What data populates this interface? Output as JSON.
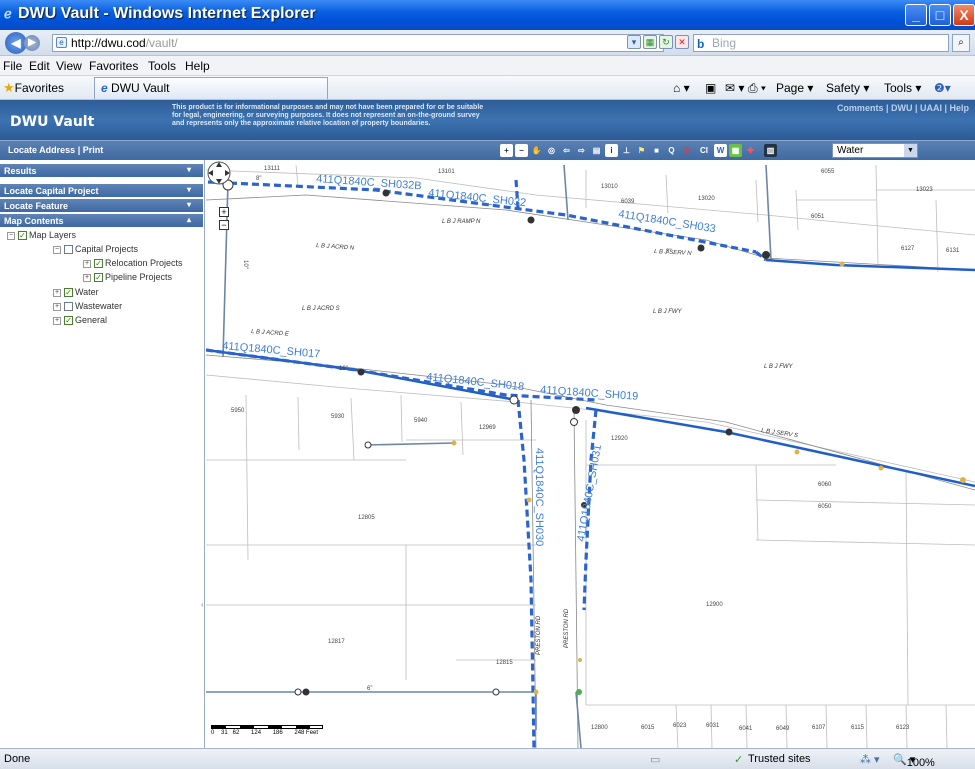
{
  "window": {
    "title": "DWU Vault - Windows Internet Explorer",
    "buttons": {
      "minimize": "_",
      "maximize": "□",
      "close": "X"
    }
  },
  "address_bar": {
    "url_host": "http://dwu.cod",
    "url_path": "/vault/",
    "search_placeholder": "Bing"
  },
  "menu": [
    "File",
    "Edit",
    "View",
    "Favorites",
    "Tools",
    "Help"
  ],
  "favorites_bar": {
    "favorites_label": "Favorites",
    "tab_label": "DWU Vault",
    "commands": [
      "Page ▾",
      "Safety ▾",
      "Tools ▾"
    ]
  },
  "app_header": {
    "brand": "DWU Vault",
    "disclaimer": "This product is for informational purposes and may not have been prepared for or be suitable for legal, engineering, or surveying purposes. It does not represent an on-the-ground survey and represents only the approximate relative location of property boundaries.",
    "links": "Comments | DWU | UAAI | Help"
  },
  "app_toolbar": {
    "locate_address": "Locate Address",
    "separator": "|",
    "print": "Print",
    "layer_select_value": "Water"
  },
  "left_panel": {
    "sections": [
      {
        "label": "Results",
        "chevron": "▾"
      },
      {
        "label": "Locate Capital Project",
        "chevron": "▾"
      },
      {
        "label": "Locate Feature",
        "chevron": "▾"
      },
      {
        "label": "Map Contents",
        "chevron": "▴"
      }
    ],
    "tree": {
      "root": "Map Layers",
      "capital_projects": "Capital Projects",
      "relocation_projects": "Relocation Projects",
      "pipeline_projects": "Pipeline Projects",
      "water": "Water",
      "wastewater": "Wastewater",
      "general": "General"
    }
  },
  "map": {
    "pipe_labels": [
      "411Q1840C_SH032B",
      "411Q1840C_SH032",
      "411Q1840C_SH033",
      "411Q1840C_SH017",
      "411Q1840C_SH018",
      "411Q1840C_SH019",
      "411Q1840C_SH030",
      "411Q1840C_SH031"
    ],
    "street_labels": [
      "L B J RAMP N",
      "L B J ACRD N",
      "L B J SERV N",
      "L B J ACRD S",
      "L B J FWY",
      "L B J ACRD E",
      "L B J FWY",
      "L B J SERV S",
      "PRESTON RD",
      "PRESTON RD"
    ],
    "parcel_labels": [
      "13111",
      "13101",
      "13010",
      "6039",
      "13020",
      "6055",
      "13023",
      "6051",
      "6127",
      "6131",
      "5950",
      "5930",
      "5940",
      "12969",
      "12920",
      "6060",
      "6050",
      "12805",
      "12900",
      "12817",
      "12815",
      "12800",
      "6015",
      "6023",
      "6031",
      "6041",
      "6049",
      "6107",
      "6115",
      "6123"
    ],
    "pipe_size_labels": [
      "8\"",
      "10\"",
      "16\"",
      "8\"",
      "6\""
    ],
    "scale_ticks": "0    31   62       124       186       248 Feet"
  },
  "status_bar": {
    "status": "Done",
    "zone": "Trusted sites",
    "zoom": "100%"
  }
}
